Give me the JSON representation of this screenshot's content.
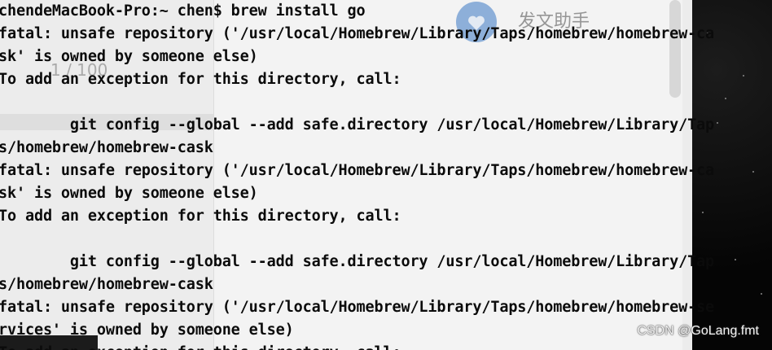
{
  "background_app": {
    "title": "发文助手",
    "counter": "1 / 100"
  },
  "terminal": {
    "lines": [
      "chendeMacBook-Pro:~ chen$ brew install go",
      "fatal: unsafe repository ('/usr/local/Homebrew/Library/Taps/homebrew/homebrew-ca",
      "sk' is owned by someone else)",
      "To add an exception for this directory, call:",
      "",
      "        git config --global --add safe.directory /usr/local/Homebrew/Library/Tap",
      "s/homebrew/homebrew-cask",
      "fatal: unsafe repository ('/usr/local/Homebrew/Library/Taps/homebrew/homebrew-ca",
      "sk' is owned by someone else)",
      "To add an exception for this directory, call:",
      "",
      "        git config --global --add safe.directory /usr/local/Homebrew/Library/Tap",
      "s/homebrew/homebrew-cask",
      "fatal: unsafe repository ('/usr/local/Homebrew/Library/Taps/homebrew/homebrew-se",
      "rvices' is owned by someone else)",
      "To add an exception for this directory, call:"
    ]
  },
  "watermark": "CSDN @GoLang.fmt",
  "colors": {
    "terminal_text": "#0b0b0b",
    "terminal_bg": "#e6e6e6",
    "desktop": "#050505"
  }
}
